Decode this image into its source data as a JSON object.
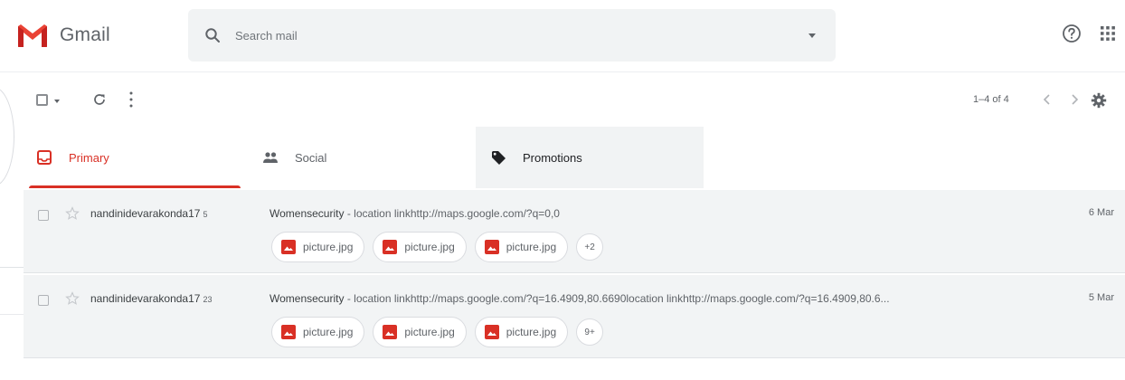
{
  "app": {
    "name": "Gmail",
    "accent": "#d93025"
  },
  "search": {
    "placeholder": "Search mail",
    "icon": "search-icon"
  },
  "header": {
    "help_icon": "help-icon",
    "apps_icon": "apps-icon"
  },
  "toolbar": {
    "pagination": "1–4 of 4"
  },
  "tabs": [
    {
      "label": "Primary",
      "icon": "inbox-icon",
      "selected": true
    },
    {
      "label": "Social",
      "icon": "people-icon",
      "selected": false
    },
    {
      "label": "Promotions",
      "icon": "tag-icon",
      "selected": false
    }
  ],
  "emails": [
    {
      "sender": "nandinidevarakonda17",
      "count": "5",
      "subject": "Womensecurity",
      "snippet": " - location linkhttp://maps.google.com/?q=0,0",
      "date": "6 Mar",
      "attachments": [
        "picture.jpg",
        "picture.jpg",
        "picture.jpg"
      ],
      "more_attachments": "+2"
    },
    {
      "sender": "nandinidevarakonda17",
      "count": "23",
      "subject": "Womensecurity",
      "snippet": " - location linkhttp://maps.google.com/?q=16.4909,80.6690location linkhttp://maps.google.com/?q=16.4909,80.6...",
      "date": "5 Mar",
      "attachments": [
        "picture.jpg",
        "picture.jpg",
        "picture.jpg"
      ],
      "more_attachments": "9+"
    }
  ]
}
